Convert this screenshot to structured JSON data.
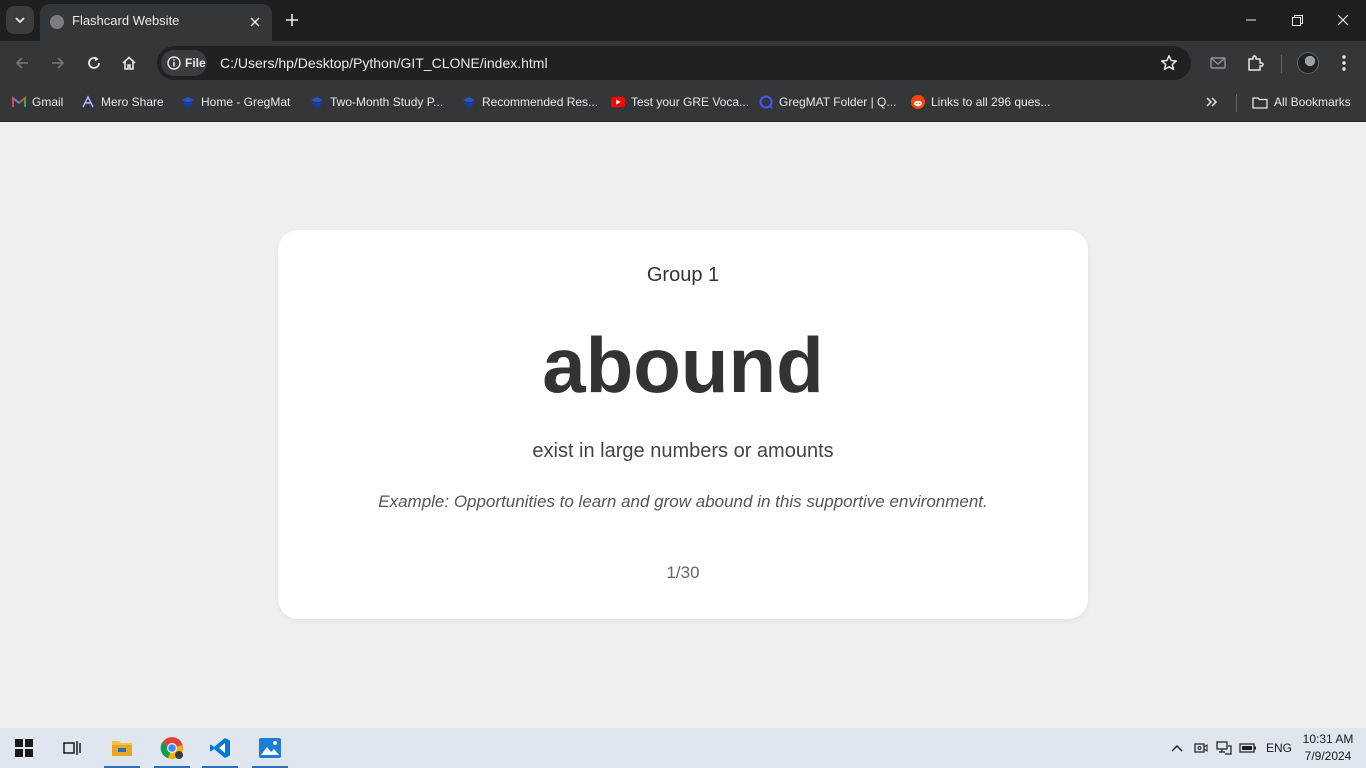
{
  "browser": {
    "tab": {
      "title": "Flashcard Website",
      "favicon": "globe-icon"
    },
    "address": {
      "scheme_chip": "File",
      "url": "C:/Users/hp/Desktop/Python/GIT_CLONE/index.html"
    },
    "bookmarks": [
      {
        "label": "Gmail",
        "icon": "gmail-icon"
      },
      {
        "label": "Mero Share",
        "icon": "mero-share-icon"
      },
      {
        "label": "Home - GregMat",
        "icon": "gregmat-icon"
      },
      {
        "label": "Two-Month Study P...",
        "icon": "gregmat-icon"
      },
      {
        "label": "Recommended Res...",
        "icon": "gregmat-icon"
      },
      {
        "label": "Test your GRE Voca...",
        "icon": "youtube-icon"
      },
      {
        "label": "GregMAT Folder | Q...",
        "icon": "quizlet-icon"
      },
      {
        "label": "Links to all 296 ques...",
        "icon": "reddit-icon"
      }
    ],
    "all_bookmarks_label": "All Bookmarks"
  },
  "flashcard": {
    "group": "Group 1",
    "word": "abound",
    "definition": "exist in large numbers or amounts",
    "example": "Example: Opportunities to learn and grow abound in this supportive environment.",
    "counter": "1/30"
  },
  "taskbar": {
    "language": "ENG",
    "time": "10:31 AM",
    "date": "7/9/2024"
  },
  "colors": {
    "page_background": "#efefef",
    "card_background": "#ffffff",
    "text_primary": "#333333",
    "browser_dark": "#35363a"
  }
}
